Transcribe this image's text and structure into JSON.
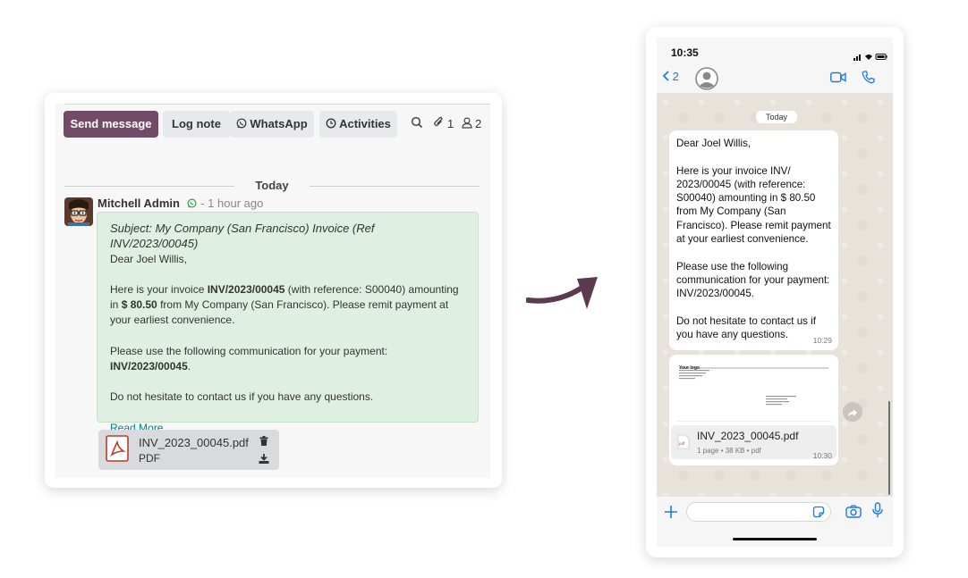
{
  "chatter": {
    "send_message": "Send message",
    "log_note": "Log note",
    "whatsapp": "WhatsApp",
    "activities": "Activities",
    "attachments_count": "1",
    "followers_count": "2",
    "today": "Today",
    "author": "Mitchell Admin",
    "time": "- 1 hour ago",
    "message": {
      "subject": "Subject: My Company (San Francisco) Invoice (Ref INV/2023/00045)",
      "greeting": "Dear Joel Willis,",
      "p1_a": "Here is your invoice ",
      "p1_invoice": "INV/2023/00045",
      "p1_b": " (with reference: S00040) amounting in ",
      "p1_amount": "$ 80.50",
      "p1_c": " from My Company (San Francisco). Please remit payment at your earliest convenience.",
      "p2_a": "Please use the following communication for your payment: ",
      "p2_ref": "INV/2023/00045",
      "p2_b": ".",
      "p3": "Do not hesitate to contact us if you have any questions.",
      "read_more": "Read More"
    },
    "attachment": {
      "name": "INV_2023_00045.pdf",
      "ext": "PDF"
    }
  },
  "phone": {
    "clock": "10:35",
    "back_count": "2",
    "day": "Today",
    "bubble": {
      "line1": "Dear Joel Willis,",
      "line2": "Here is your invoice INV/ 2023/00045 (with reference: S00040) amounting in $ 80.50 from My Company (San Francisco). Please remit payment at your earliest convenience.",
      "line3": "Please use the following communication for your payment: INV/2023/00045.",
      "line4": "Do not hesitate to contact us if you have any questions.",
      "time": "10:29"
    },
    "doc": {
      "logo": "Your logo",
      "filename": "INV_2023_00045.pdf",
      "meta": "1 page • 38 KB • pdf",
      "time": "10:30"
    }
  },
  "colors": {
    "primary": "#714b67",
    "message_bg": "#dff0e2",
    "link": "#017e84",
    "whatsapp_green": "#25d366",
    "ios_blue": "#1f7ae0"
  }
}
